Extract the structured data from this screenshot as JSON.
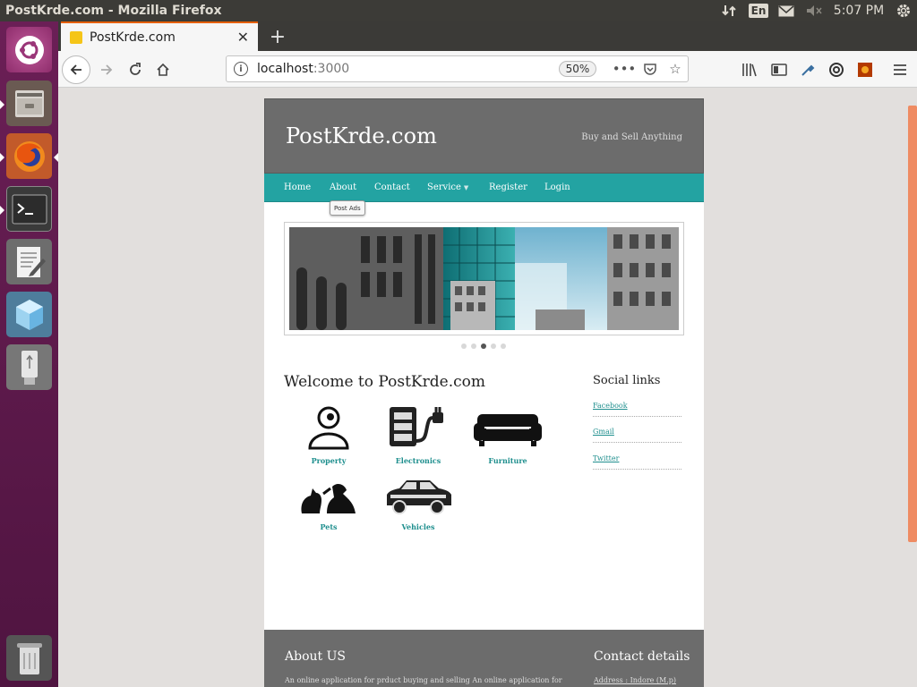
{
  "window": {
    "title": "PostKrde.com - Mozilla Firefox"
  },
  "tray": {
    "input_lang": "En",
    "clock": "5:07 PM"
  },
  "browser": {
    "tab_title": "PostKrde.com",
    "url_host": "localhost",
    "url_port": ":3000",
    "zoom": "50%"
  },
  "site": {
    "title": "PostKrde.com",
    "tagline": "Buy and Sell Anything",
    "nav": [
      "Home",
      "About",
      "Contact",
      "Service",
      "Register",
      "Login"
    ],
    "tooltip": "Post Ads",
    "welcome_title": "Welcome to PostKrde.com",
    "categories": [
      "Property",
      "Electronics",
      "Furniture",
      "Pets",
      "Vehicles"
    ],
    "social_title": "Social links",
    "social_links": [
      "Facebook",
      "Gmail",
      "Twitter"
    ],
    "footer": {
      "about_title": "About US",
      "about_text": "An online application for prduct buying and selling An online application for",
      "contact_title": "Contact details",
      "contact_address": "Address : Indore (M.p)"
    }
  },
  "colors": {
    "accent": "#23a3a2",
    "header": "#6c6c6c",
    "link": "#1f8f8e"
  }
}
